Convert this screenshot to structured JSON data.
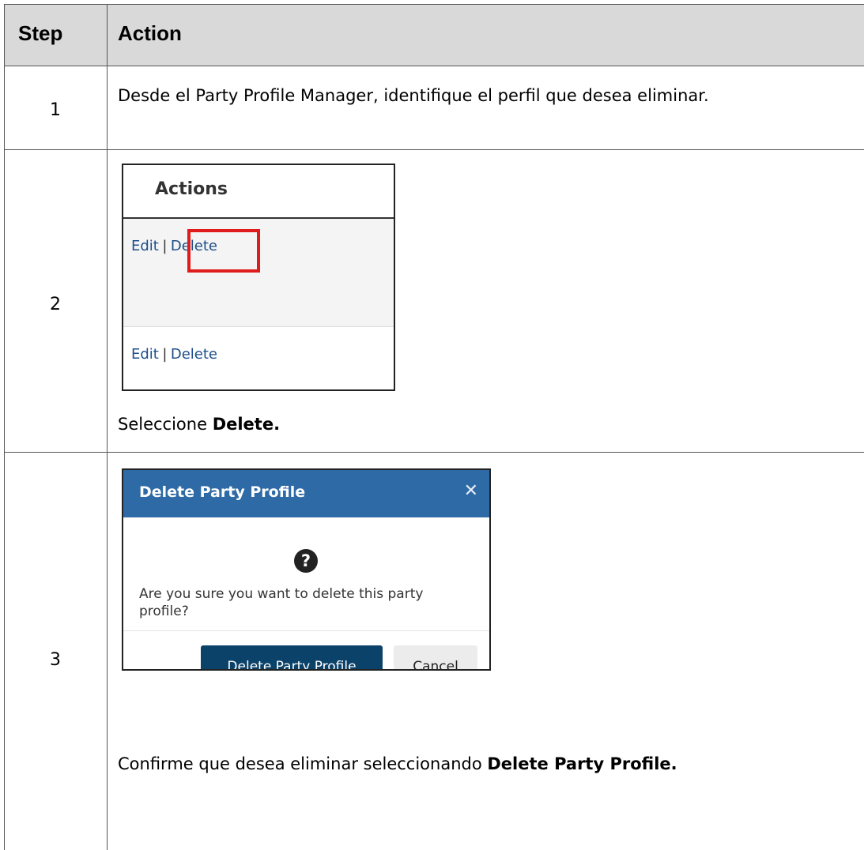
{
  "table": {
    "headers": {
      "step": "Step",
      "action": "Action"
    },
    "rows": [
      {
        "step": "1",
        "text": "Desde el Party Profile Manager, identifique el perfil que desea eliminar."
      },
      {
        "step": "2",
        "text_prefix": "Seleccione ",
        "text_bold": "Delete."
      },
      {
        "step": "3",
        "text_prefix": "Confirme que desea eliminar seleccionando ",
        "text_bold": "Delete Party Profile."
      }
    ]
  },
  "actions_panel": {
    "title": "Actions",
    "rows": [
      {
        "edit": "Edit",
        "sep": "|",
        "delete": "Delete",
        "highlighted": true
      },
      {
        "edit": "Edit",
        "sep": "|",
        "delete": "Delete",
        "highlighted": false
      }
    ]
  },
  "dialog": {
    "title": "Delete Party Profile",
    "close_icon": "close-icon",
    "question_icon": "question-circle-icon",
    "message": "Are you sure you want to delete this party profile?",
    "confirm_label": "Delete Party Profile",
    "cancel_label": "Cancel",
    "header_color": "#2e6aa5",
    "confirm_color": "#0b4269"
  },
  "highlight_color": "#e01b1b"
}
